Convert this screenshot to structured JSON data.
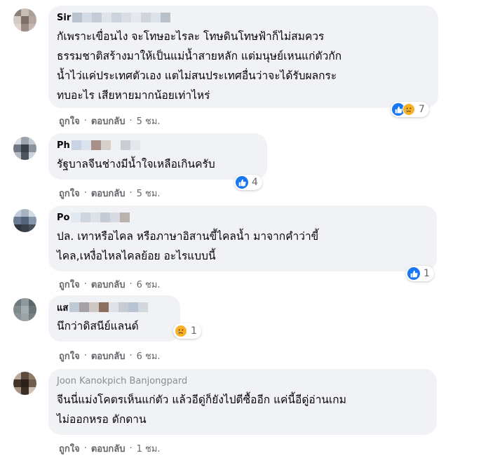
{
  "comments": [
    {
      "author": "Sir",
      "text": "กัเพราะเขื่อนไง จะโทษอะไรละ โทษดินโทษฟ้าก็ไม่สมควร\nธรรมชาติสร้างมาให้เป็นแม่น้ำสายหลัก แต่มนุษย์เหนแก่ตัวกัก\nน้ำไว่แค่ประเทศตัวเอง แตไม่สนประเทศอื่นว่าจะได้รับผลกระ\nทบอะไร เสียหายมากน้อยเท่าไหร่",
      "reaction_count": "7",
      "like_label": "ถูกใจ",
      "reply_label": "ตอบกลับ",
      "time": "5 ชม."
    },
    {
      "author": "Ph",
      "text": "รัฐบาลจีนช่างมีน้ำใจเหลือเกินครับ",
      "reaction_count": "4",
      "like_label": "ถูกใจ",
      "reply_label": "ตอบกลับ",
      "time": "5 ชม."
    },
    {
      "author": "Po",
      "text": "ปล. เทาหรือไคล หรือภาษาอิสานขี้ไคลน้ำ มาจากคำว่าขี้\nไคล,เหงื่อไหลไคลย้อย อะไรแบบนี้",
      "reaction_count": "1",
      "like_label": "ถูกใจ",
      "reply_label": "ตอบกลับ",
      "time": "6 ชม."
    },
    {
      "author": "แส",
      "text": "นึกว่าดิสนีย์แลนด์",
      "reaction_count": "1",
      "like_label": "ถูกใจ",
      "reply_label": "ตอบกลับ",
      "time": "6 ชม."
    },
    {
      "author": "Joon Kanokpich Banjongpard",
      "text": "จีนนี่แม่งโคตรเห็นแก่ตัว แล้วอีดู่ก็ยังไปตีซื้ออีก แค่นี้อีดู่อ่านเกม\nไม่ออกหรอ ดักดาน",
      "like_label": "ถูกใจ",
      "reply_label": "ตอบกลับ",
      "time": "1 ชม."
    }
  ],
  "separator": "·",
  "colors": {
    "bubble": "#f0f2f5",
    "like_blue": "#1877f2",
    "sad_yellow": "#f7b125",
    "meta_gray": "#65676b"
  },
  "icons": {
    "like": "thumbs-up-icon",
    "sad": "sad-face-icon"
  }
}
